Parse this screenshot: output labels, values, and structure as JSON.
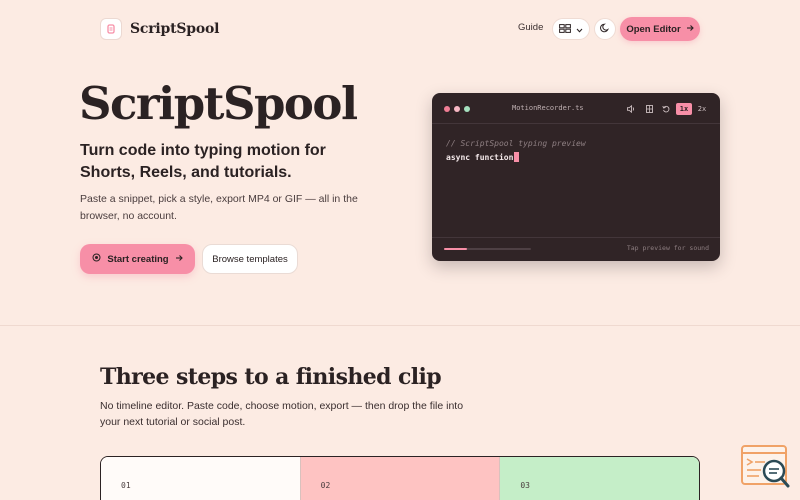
{
  "header": {
    "brand": "ScriptSpool",
    "nav_guide": "Guide",
    "open_editor": "Open Editor"
  },
  "hero": {
    "title": "ScriptSpool",
    "subtitle": "Turn code into typing motion for Shorts, Reels, and tutorials.",
    "description": "Paste a snippet, pick a style, export MP4 or GIF — all in the browser, no account.",
    "primary_button": "Start creating",
    "secondary_button": "Browse templates"
  },
  "terminal": {
    "filename": "MotionRecorder.ts",
    "speed_1x": "1x",
    "speed_2x": "2x",
    "code_comment": "// ScriptSpool typing preview",
    "code_typed": "async function",
    "progress_percent": 26,
    "tap_hint": "Tap preview for sound"
  },
  "steps": {
    "title": "Three steps to a finished clip",
    "description": "No timeline editor. Paste code, choose motion, export — then drop the file into your next tutorial or social post.",
    "cards": [
      {
        "number": "01",
        "color": "#fffbf9"
      },
      {
        "number": "02",
        "color": "#fec3c2"
      },
      {
        "number": "03",
        "color": "#c5eec8"
      }
    ]
  },
  "colors": {
    "background": "#fcebe3",
    "accent": "#f78fa7",
    "terminal_bg": "#302426",
    "dot_red": "#f07e95",
    "dot_pink": "#f7b8c4",
    "dot_green": "#a6e1bf"
  }
}
